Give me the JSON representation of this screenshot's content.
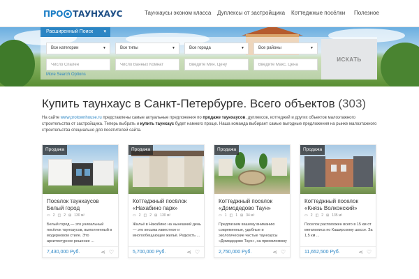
{
  "header": {
    "logo_left": "ПРО",
    "logo_right": "ТАУНХАУС",
    "nav": [
      {
        "label": "Таунхаусы эконом класса"
      },
      {
        "label": "Дуплексы от застройщика"
      },
      {
        "label": "Коттеджные посёлки"
      },
      {
        "label": "Полезное"
      }
    ]
  },
  "search": {
    "tab_label": "Расширенный Поиск",
    "selects": [
      "Все категории",
      "Все типы",
      "Все города",
      "Все районы"
    ],
    "placeholders": [
      "Число Спален",
      "Число Ванных Комнат",
      "Введите Мин. Цену",
      "Введите Макс. Цена"
    ],
    "button": "ИСКАТЬ",
    "more": "More Search Options"
  },
  "main": {
    "title": "Купить таунхаус в Санкт-Петербурге. Всего объектов",
    "count": "(303)",
    "intro": {
      "p1": "На сайте ",
      "link": "www.protownhouse.ru",
      "p2": " представлены самые актуальные предложения по ",
      "b1": "продаже таунхаусов",
      "p3": ", дуплексов, коттеджей и других объектов малоэтажного строительства от застройщика. Теперь выбрать и ",
      "b2": "купить таунхаус",
      "p4": " будет намного проще. Наша команда выбирает самые выгодные предложения на рынке малоэтажного строительства специально для посетителей сайта."
    }
  },
  "cards": [
    {
      "tag": "Продажа",
      "name": "Поселок таунхаусов Белый город",
      "beds": "2",
      "baths": "2",
      "area": "130 м²",
      "desc": "Белый город — это уникальный посёлок таунхаусов, выполненный в модерновом стиле. Это архитектурное решение ...",
      "price": "7,430,000 Руб."
    },
    {
      "tag": "Продажа",
      "name": "Коттеджный посёлок «Нахабино парк»",
      "beds": "2",
      "baths": "2",
      "area": "130 м²",
      "desc": "Жильё в Нахабино на нынешний день — это весьма известное и многообещающее жильё. Редкость ...",
      "price": "5,700,000 Руб."
    },
    {
      "tag": "Продажа",
      "name": "Коттеджный поселок «Домодедово Таун»",
      "beds": "1",
      "baths": "1",
      "area": "34 м²",
      "desc": "Предлагаем вашему вниманию современные, удобные и экологические чистые таунхаусы «Домодедово Таун», на приемлемому ...",
      "price": "2,750,000 Руб."
    },
    {
      "tag": "Продажа",
      "name": "Коттеджный поселок «Князь Волконский»",
      "beds": "2",
      "baths": "2",
      "area": "135 м²",
      "desc": "Поселок расположен всего в 15 км от мегаполиса по Каширскому шоссе. За 1,5 км ...",
      "price": "11,652,500 Руб."
    }
  ]
}
